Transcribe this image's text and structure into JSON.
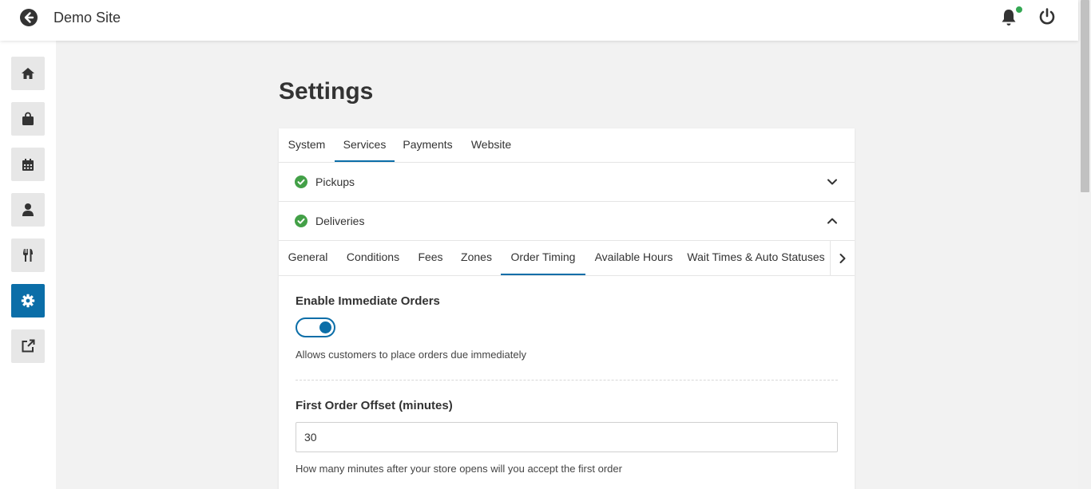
{
  "header": {
    "site_name": "Demo Site",
    "icons": [
      "back-arrow-icon",
      "bell-icon",
      "power-icon"
    ],
    "notification_dot_color": "#34a853"
  },
  "sidebar": {
    "items": [
      {
        "name": "home",
        "icon": "home-icon",
        "active": false
      },
      {
        "name": "orders",
        "icon": "shopping-bag-icon",
        "active": false
      },
      {
        "name": "calendar",
        "icon": "calendar-icon",
        "active": false
      },
      {
        "name": "customers",
        "icon": "user-icon",
        "active": false
      },
      {
        "name": "menus",
        "icon": "utensils-icon",
        "active": false
      },
      {
        "name": "settings",
        "icon": "gear-icon",
        "active": true
      },
      {
        "name": "external-link",
        "icon": "external-link-icon",
        "active": false
      }
    ],
    "accent_color": "#0b6ea8"
  },
  "page": {
    "title": "Settings"
  },
  "tabs": [
    {
      "label": "System",
      "active": false
    },
    {
      "label": "Services",
      "active": true
    },
    {
      "label": "Payments",
      "active": false
    },
    {
      "label": "Website",
      "active": false
    }
  ],
  "accordions": [
    {
      "label": "Pickups",
      "expanded": false,
      "icon": "check-circle-icon"
    },
    {
      "label": "Deliveries",
      "expanded": true,
      "icon": "check-circle-icon"
    }
  ],
  "subtabs": [
    {
      "label": "General",
      "active": false
    },
    {
      "label": "Conditions",
      "active": false
    },
    {
      "label": "Fees",
      "active": false
    },
    {
      "label": "Zones",
      "active": false
    },
    {
      "label": "Order Timing",
      "active": true
    },
    {
      "label": "Available Hours",
      "active": false
    },
    {
      "label": "Wait Times & Auto Statuses",
      "active": false
    }
  ],
  "form": {
    "immediate_orders": {
      "label": "Enable Immediate Orders",
      "enabled": true,
      "help": "Allows customers to place orders due immediately"
    },
    "first_order_offset": {
      "label": "First Order Offset (minutes)",
      "value": "30",
      "help": "How many minutes after your store opens will you accept the first order"
    }
  }
}
